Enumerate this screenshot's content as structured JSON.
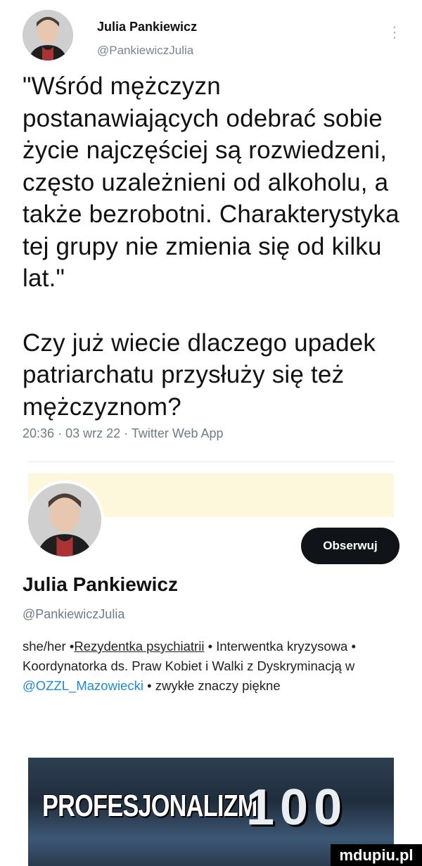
{
  "tweet": {
    "author_name": "Julia Pankiewicz",
    "author_handle": "@PankiewiczJulia",
    "quote": "\"Wśród mężczyzn postanawiających odebrać sobie życie najczęściej są rozwiedzeni, często uzależnieni od alkoholu, a także bezrobotni. Charakterystyka tej grupy nie zmienia się od kilku lat.\"",
    "question": "Czy już wiecie dlaczego upadek patriarchatu przysłuży się też mężczyznom?",
    "time": "20:36",
    "date": "03 wrz 22",
    "source": "Twitter Web App",
    "separator": "·"
  },
  "profile": {
    "follow_label": "Obserwuj",
    "name": "Julia Pankiewicz",
    "handle": "@PankiewiczJulia",
    "bio_pronouns": "she/her",
    "bio_role": "Rezydentka psychiatrii",
    "bio_part2": "Interwentka kryzysowa",
    "bio_part3": "Koordynatorka ds. Praw Kobiet i Walki z Dyskryminacją w",
    "bio_mention": "@OZZL_Mazowiecki",
    "bio_part4": "zwykłe znaczy piękne",
    "bio_sep": "•"
  },
  "bottom_image": {
    "text": "PROFESJONALIZM",
    "number": "100"
  },
  "watermark": "mdupiu.pl",
  "icons": {
    "more": "more-vertical-icon"
  }
}
